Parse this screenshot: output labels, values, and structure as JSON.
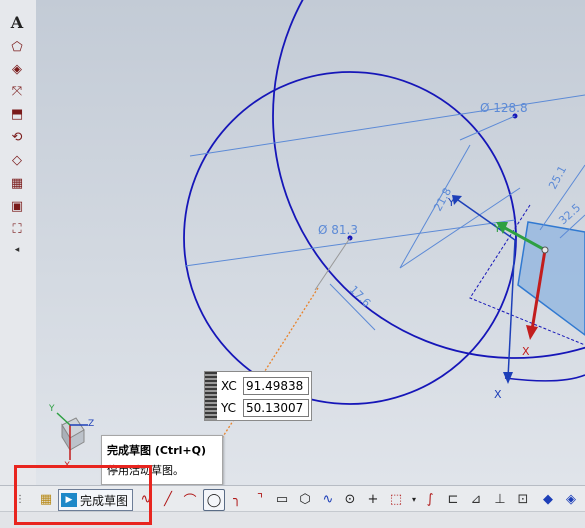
{
  "left_toolbar": {
    "text_tool_label": "A",
    "icons": [
      "text-icon",
      "profile-icon",
      "plane-icon",
      "datum-axis-icon",
      "extrude-icon",
      "revolve-icon",
      "mirror-icon",
      "pattern-icon",
      "mesh-icon",
      "view-icon",
      "more-icon"
    ]
  },
  "dimensions": {
    "d1": "Ø 128.8",
    "d2": "Ø 81.3",
    "d3": "21.8",
    "d4": "17.6",
    "d5": "25.1",
    "d6": "32.5"
  },
  "axes": {
    "x_label": "X",
    "y_label": "Y",
    "z_label": "Z",
    "triad_x": "X",
    "triad_y": "Y",
    "triad_z": "Z",
    "colors": {
      "x": "#c21d1d",
      "y": "#2ea043",
      "z": "#1d3fb8"
    }
  },
  "coordinate_input": {
    "xc_label": "XC",
    "xc_value": "91.49838",
    "yc_label": "YC",
    "yc_value": "50.13007"
  },
  "tooltip": {
    "title": "完成草图 (Ctrl+Q)",
    "description": "停用活动草图。"
  },
  "bottom_toolbar": {
    "finish_sketch_label": "完成草图",
    "tools": [
      "profile-tool",
      "line-tool",
      "arc-tool",
      "circle-tool",
      "fillet-tool",
      "chamfer-tool",
      "rectangle-tool",
      "polygon-tool",
      "spline-tool",
      "point-tool",
      "cross-tool",
      "offset-tool",
      "trim-tool",
      "extend-tool",
      "corner-tool",
      "constraint-tool",
      "display-tool",
      "fix-tool"
    ]
  },
  "highlight_color": "#e8251f",
  "curve_color": "#1616b8",
  "dimension_color": "#5c8ad6"
}
